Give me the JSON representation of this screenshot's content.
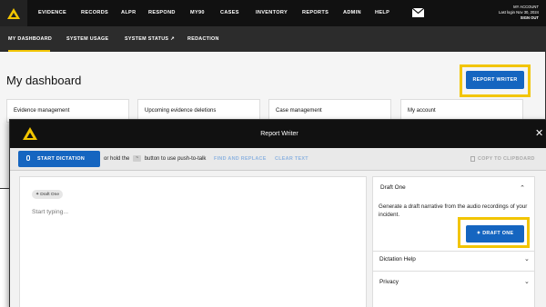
{
  "brand": {
    "accent": "#f2c500",
    "primary": "#1565c0",
    "dark": "#111111"
  },
  "topnav": {
    "items": [
      "EVIDENCE",
      "RECORDS",
      "ALPR",
      "RESPOND",
      "MY90",
      "CASES",
      "INVENTORY",
      "REPORTS",
      "ADMIN",
      "HELP"
    ],
    "account": {
      "title": "MY ACCOUNT",
      "last_login": "Last login Nov 30, 2024",
      "sign_out": "SIGN OUT"
    }
  },
  "subnav": {
    "items": [
      "MY DASHBOARD",
      "SYSTEM USAGE",
      "SYSTEM STATUS ↗",
      "REDACTION"
    ]
  },
  "dashboard": {
    "title": "My dashboard",
    "report_writer_button": "REPORT WRITER",
    "cards": [
      "Evidence management",
      "Upcoming evidence deletions",
      "Case management",
      "My account"
    ]
  },
  "report_writer": {
    "title": "Report Writer",
    "start_dictation": "START DICTATION",
    "hint_before": "or hold the",
    "hint_key": "~",
    "hint_after": "button to use push-to-talk",
    "find_replace": "FIND AND REPLACE",
    "clear_text": "CLEAR TEXT",
    "copy": "COPY TO CLIPBOARD",
    "chip": "Draft One",
    "placeholder": "Start typing...",
    "side": {
      "draft_one_title": "Draft One",
      "draft_one_desc": "Generate a draft narrative from the audio recordings of your incident.",
      "draft_one_button": "DRAFT ONE",
      "dictation_help": "Dictation Help",
      "privacy": "Privacy"
    }
  }
}
